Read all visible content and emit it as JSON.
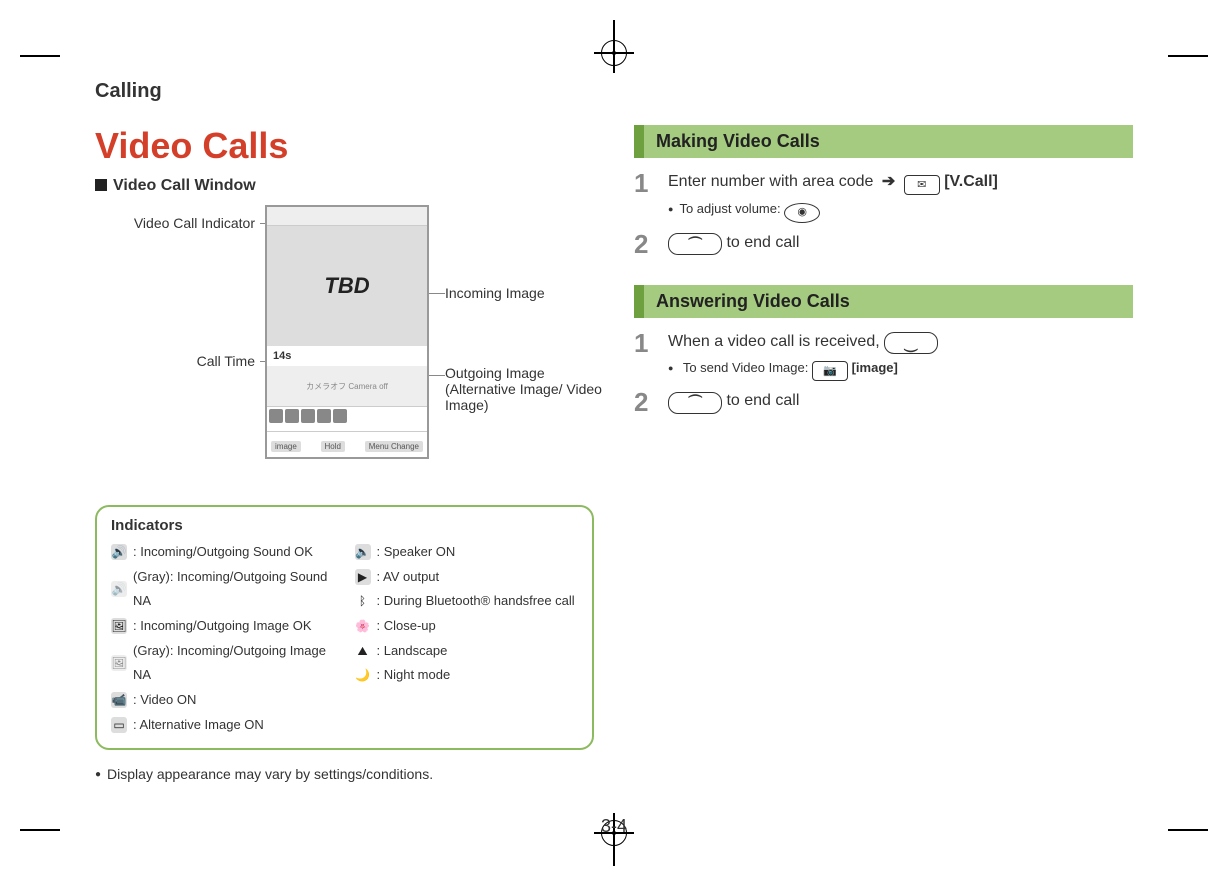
{
  "chapter": "Calling",
  "title": "Video Calls",
  "subheading": "Video Call Window",
  "diagram": {
    "label_indicator": "Video Call Indicator",
    "label_calltime": "Call Time",
    "label_incoming": "Incoming Image",
    "label_outgoing": "Outgoing Image (Alternative Image/ Video Image)",
    "screen_tbd": "TBD",
    "screen_time": "14s",
    "screen_camoff": "カメラオフ Camera off",
    "soft_left": "image",
    "soft_mid": "Hold",
    "soft_right": "Menu Change"
  },
  "indicators": {
    "heading": "Indicators",
    "left": [
      ": Incoming/Outgoing Sound OK",
      "(Gray): Incoming/Outgoing Sound NA",
      ": Incoming/Outgoing Image OK",
      "(Gray): Incoming/Outgoing Image NA",
      ": Video ON",
      ": Alternative Image ON"
    ],
    "right": [
      ": Speaker ON",
      ": AV output",
      ": During Bluetooth® handsfree call",
      ": Close-up",
      ": Landscape",
      ": Night mode"
    ]
  },
  "note": "Display appearance may vary by settings/conditions.",
  "making": {
    "heading": "Making Video Calls",
    "step1_text": "Enter number with area code",
    "step1_button": "[V.Call]",
    "step1_sub": "To adjust volume:",
    "step2_text": "to end call"
  },
  "answering": {
    "heading": "Answering Video Calls",
    "step1_text": "When a video call is received,",
    "step1_sub_a": "To send Video Image:",
    "step1_sub_b": "[image]",
    "step2_text": "to end call"
  },
  "page_number": "3-4"
}
